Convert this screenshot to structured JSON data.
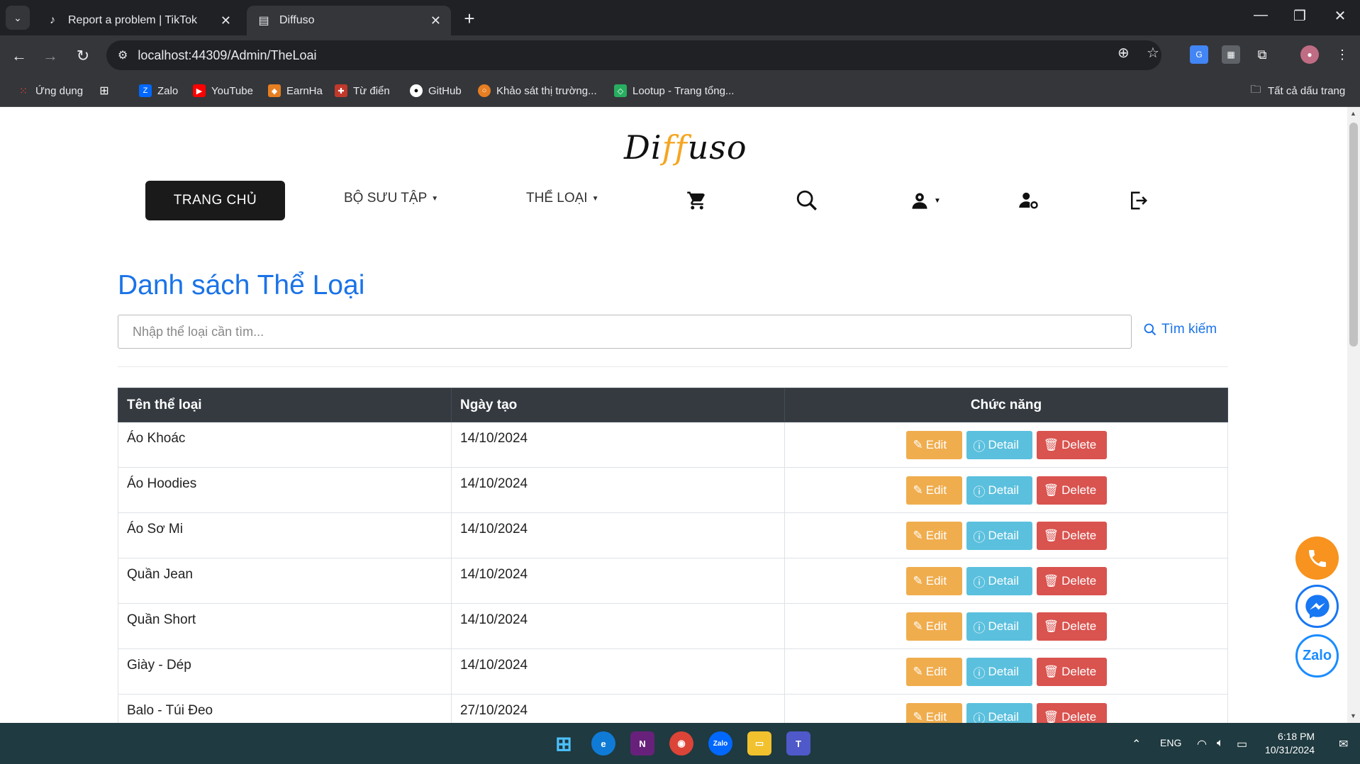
{
  "browser": {
    "tabs": [
      {
        "title": "Report a problem | TikTok",
        "active": false
      },
      {
        "title": "Diffuso",
        "active": true
      }
    ],
    "url": "localhost:44309/Admin/TheLoai",
    "bookmarks": [
      {
        "label": "Ứng dụng"
      },
      {
        "label": "Zalo"
      },
      {
        "label": "YouTube"
      },
      {
        "label": "EarnHa"
      },
      {
        "label": "Từ điển"
      },
      {
        "label": "GitHub"
      },
      {
        "label": "Khảo sát thị trường..."
      },
      {
        "label": "Lootup - Trang tổng..."
      }
    ],
    "all_bookmarks": "Tất cả dấu trang"
  },
  "site": {
    "logo": {
      "pre": "Di",
      "accent": "ff",
      "post": "uso"
    },
    "nav": {
      "home": "TRANG CHỦ",
      "collection": "BỘ SƯU TẬP",
      "category": "THỂ LOẠI"
    }
  },
  "main": {
    "heading": "Danh sách Thể Loại",
    "search_placeholder": "Nhập thể loại cần tìm...",
    "search_button": "Tìm kiếm",
    "table": {
      "headers": [
        "Tên thể loại",
        "Ngày tạo",
        "Chức năng"
      ],
      "rows": [
        {
          "name": "Áo Khoác",
          "date": "14/10/2024"
        },
        {
          "name": "Áo Hoodies",
          "date": "14/10/2024"
        },
        {
          "name": "Áo Sơ Mi",
          "date": "14/10/2024"
        },
        {
          "name": "Quần Jean",
          "date": "14/10/2024"
        },
        {
          "name": "Quần Short",
          "date": "14/10/2024"
        },
        {
          "name": "Giày - Dép",
          "date": "14/10/2024"
        },
        {
          "name": "Balo - Túi Đeo",
          "date": "27/10/2024"
        }
      ],
      "actions": {
        "edit": "Edit",
        "detail": "Detail",
        "delete": "Delete"
      }
    }
  },
  "floating": {
    "zalo": "Zalo"
  },
  "taskbar": {
    "lang": "ENG",
    "time": "6:18 PM",
    "date": "10/31/2024"
  },
  "colors": {
    "accent_blue": "#1a73e8",
    "edit": "#f0ad4e",
    "detail": "#5bc0de",
    "delete": "#d9534f",
    "logo_accent": "#f5a623"
  }
}
